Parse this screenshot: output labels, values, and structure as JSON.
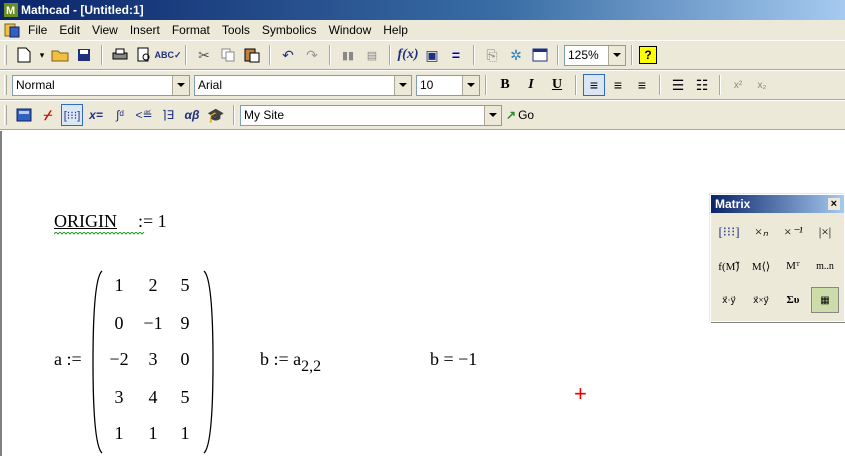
{
  "window": {
    "title": "Mathcad - [Untitled:1]"
  },
  "menubar": {
    "items": [
      "File",
      "Edit",
      "View",
      "Insert",
      "Format",
      "Tools",
      "Symbolics",
      "Window",
      "Help"
    ]
  },
  "toolbar_standard": {
    "zoom_value": "125%"
  },
  "toolbar_format": {
    "style_value": "Normal",
    "font_value": "Arial",
    "size_value": "10",
    "bold_label": "B",
    "italic_label": "I",
    "underline_label": "U"
  },
  "toolbar_math": {
    "site_value": "My Site",
    "go_label": "Go"
  },
  "worksheet": {
    "origin_lhs": "ORIGIN",
    "origin_op": ":= 1",
    "a_lhs": "a :=",
    "matrix": [
      [
        "1",
        "2",
        "5"
      ],
      [
        "0",
        "−1",
        "9"
      ],
      [
        "−2",
        "3",
        "0"
      ],
      [
        "3",
        "4",
        "5"
      ],
      [
        "1",
        "1",
        "1"
      ]
    ],
    "b_def": "b := a",
    "b_sub": "2,2",
    "b_eval": "b = −1",
    "cursor": "+"
  },
  "matrix_palette": {
    "title": "Matrix",
    "close": "×"
  },
  "colors": {
    "title_start": "#0a246a",
    "title_end": "#a6caf0",
    "chrome": "#ece9d8",
    "cursor": "#e00000"
  }
}
